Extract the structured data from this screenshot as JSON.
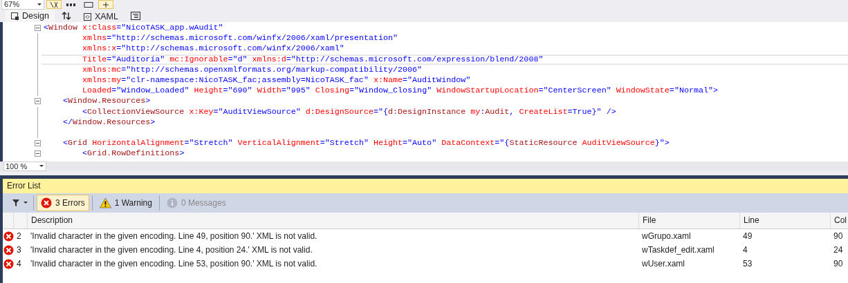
{
  "toolbar": {
    "zoom": "67%",
    "buttons": [
      {
        "kind": "fx",
        "on": true
      },
      {
        "kind": "grid",
        "on": false
      },
      {
        "kind": "snap",
        "on": false
      },
      {
        "kind": "pointer",
        "on": true
      }
    ]
  },
  "view_tabs": [
    {
      "kind": "design-tab",
      "label": "Design",
      "selected": true
    },
    {
      "kind": "swap"
    },
    {
      "kind": "xaml-tab",
      "label": "XAML",
      "selected": false
    },
    {
      "kind": "outline"
    }
  ],
  "editor": {
    "zoom": "100 %",
    "lines": [
      {
        "kind": "element",
        "fold": true,
        "current": false,
        "tokens": [
          {
            "kind": "punct",
            "text": "<"
          },
          {
            "kind": "tag",
            "text": "Window"
          },
          {
            "kind": "attr",
            "text": " x:Class"
          },
          {
            "kind": "punct",
            "text": "="
          },
          {
            "kind": "value",
            "text": "\"NicoTASK_app.wAudit\""
          }
        ],
        "children": [
          {
            "kind": "continuation",
            "fold": false,
            "current": false,
            "tokens": [
              {
                "kind": "attr",
                "text": "xmlns"
              },
              {
                "kind": "punct",
                "text": "="
              },
              {
                "kind": "value",
                "text": "\"http://schemas.microsoft.com/winfx/2006/xaml/presentation\""
              }
            ]
          },
          {
            "kind": "continuation",
            "fold": false,
            "current": false,
            "tokens": [
              {
                "kind": "attr",
                "text": "xmlns:x"
              },
              {
                "kind": "punct",
                "text": "="
              },
              {
                "kind": "value",
                "text": "\"http://schemas.microsoft.com/winfx/2006/xaml\""
              }
            ]
          },
          {
            "kind": "continuation",
            "fold": false,
            "current": true,
            "tokens": [
              {
                "kind": "attr",
                "text": "Title"
              },
              {
                "kind": "punct",
                "text": "="
              },
              {
                "kind": "value",
                "text": "\"Auditoría\""
              },
              {
                "kind": "attr",
                "text": " mc:Ignorable"
              },
              {
                "kind": "punct",
                "text": "="
              },
              {
                "kind": "value",
                "text": "\"d\""
              },
              {
                "kind": "attr",
                "text": " xmlns:d"
              },
              {
                "kind": "punct",
                "text": "="
              },
              {
                "kind": "value",
                "text": "\"http://schemas.microsoft.com/expression/blend/2008\""
              }
            ]
          },
          {
            "kind": "continuation",
            "fold": false,
            "current": false,
            "tokens": [
              {
                "kind": "attr",
                "text": "xmlns:mc"
              },
              {
                "kind": "punct",
                "text": "="
              },
              {
                "kind": "value",
                "text": "\"http://schemas.openxmlformats.org/markup-compatibility/2006\""
              }
            ]
          },
          {
            "kind": "continuation",
            "fold": false,
            "current": false,
            "tokens": [
              {
                "kind": "attr",
                "text": "xmlns:my"
              },
              {
                "kind": "punct",
                "text": "="
              },
              {
                "kind": "value",
                "text": "\"clr-namespace:NicoTASK_fac;assembly=NicoTASK_fac\""
              },
              {
                "kind": "attr",
                "text": " x:Name"
              },
              {
                "kind": "punct",
                "text": "="
              },
              {
                "kind": "value",
                "text": "\"AuditWindow\""
              }
            ]
          },
          {
            "kind": "continuation",
            "fold": false,
            "current": false,
            "tokens": [
              {
                "kind": "attr",
                "text": "Loaded"
              },
              {
                "kind": "punct",
                "text": "="
              },
              {
                "kind": "value",
                "text": "\"Window_Loaded\""
              },
              {
                "kind": "attr",
                "text": " Height"
              },
              {
                "kind": "punct",
                "text": "="
              },
              {
                "kind": "value",
                "text": "\"690\""
              },
              {
                "kind": "attr",
                "text": " Width"
              },
              {
                "kind": "punct",
                "text": "="
              },
              {
                "kind": "value",
                "text": "\"995\""
              },
              {
                "kind": "attr",
                "text": " Closing"
              },
              {
                "kind": "punct",
                "text": "="
              },
              {
                "kind": "value",
                "text": "\"Window_Closing\""
              },
              {
                "kind": "attr",
                "text": " WindowStartupLocation"
              },
              {
                "kind": "punct",
                "text": "="
              },
              {
                "kind": "value",
                "text": "\"CenterScreen\""
              },
              {
                "kind": "attr",
                "text": " WindowState"
              },
              {
                "kind": "punct",
                "text": "="
              },
              {
                "kind": "value",
                "text": "\"Normal\""
              },
              {
                "kind": "punct",
                "text": ">"
              }
            ]
          },
          {
            "kind": "element",
            "fold": true,
            "current": false,
            "tokens": [
              {
                "kind": "punct",
                "text": "<"
              },
              {
                "kind": "tag",
                "text": "Window.Resources"
              },
              {
                "kind": "punct",
                "text": ">"
              }
            ],
            "children": [
              {
                "kind": "element",
                "fold": false,
                "current": false,
                "tokens": [
                  {
                    "kind": "punct",
                    "text": "<"
                  },
                  {
                    "kind": "tag",
                    "text": "CollectionViewSource"
                  },
                  {
                    "kind": "attr",
                    "text": " x:Key"
                  },
                  {
                    "kind": "punct",
                    "text": "="
                  },
                  {
                    "kind": "value",
                    "text": "\"AuditViewSource\""
                  },
                  {
                    "kind": "attr",
                    "text": " d:DesignSource"
                  },
                  {
                    "kind": "punct",
                    "text": "=\"{"
                  },
                  {
                    "kind": "tag",
                    "text": "d:DesignInstance"
                  },
                  {
                    "kind": "attr",
                    "text": " my"
                  },
                  {
                    "kind": "punct",
                    "text": ":"
                  },
                  {
                    "kind": "tag",
                    "text": "Audit"
                  },
                  {
                    "kind": "punct",
                    "text": ","
                  },
                  {
                    "kind": "attr",
                    "text": " CreateList"
                  },
                  {
                    "kind": "punct",
                    "text": "=True}\" />"
                  }
                ]
              }
            ]
          },
          {
            "kind": "element",
            "fold": false,
            "current": false,
            "tokens": [
              {
                "kind": "punct",
                "text": "</"
              },
              {
                "kind": "tag",
                "text": "Window.Resources"
              },
              {
                "kind": "punct",
                "text": ">"
              }
            ]
          },
          {
            "kind": "blank",
            "fold": false
          },
          {
            "kind": "element",
            "fold": true,
            "current": false,
            "tokens": [
              {
                "kind": "punct",
                "text": "<"
              },
              {
                "kind": "tag",
                "text": "Grid"
              },
              {
                "kind": "attr",
                "text": " HorizontalAlignment"
              },
              {
                "kind": "punct",
                "text": "="
              },
              {
                "kind": "value",
                "text": "\"Stretch\""
              },
              {
                "kind": "attr",
                "text": " VerticalAlignment"
              },
              {
                "kind": "punct",
                "text": "="
              },
              {
                "kind": "value",
                "text": "\"Stretch\""
              },
              {
                "kind": "attr",
                "text": " Height"
              },
              {
                "kind": "punct",
                "text": "="
              },
              {
                "kind": "value",
                "text": "\"Auto\""
              },
              {
                "kind": "attr",
                "text": " DataContext"
              },
              {
                "kind": "punct",
                "text": "=\"{"
              },
              {
                "kind": "tag",
                "text": "StaticResource"
              },
              {
                "kind": "attr",
                "text": " AuditViewSource"
              },
              {
                "kind": "punct",
                "text": "}\">"
              }
            ],
            "children": [
              {
                "kind": "element",
                "fold": true,
                "current": false,
                "tokens": [
                  {
                    "kind": "punct",
                    "text": "<"
                  },
                  {
                    "kind": "tag",
                    "text": "Grid.RowDefinitions"
                  },
                  {
                    "kind": "punct",
                    "text": ">"
                  }
                ]
              }
            ]
          }
        ]
      }
    ]
  },
  "error_list": {
    "title": "Error List",
    "filters": [
      {
        "kind": "error",
        "label": "3 Errors",
        "selected": true,
        "disabled": false
      },
      {
        "kind": "warning",
        "label": "1 Warning",
        "selected": false,
        "disabled": false
      },
      {
        "kind": "info",
        "label": "0 Messages",
        "selected": false,
        "disabled": true
      }
    ],
    "columns": [
      "Description",
      "File",
      "Line",
      "Col"
    ],
    "rows": [
      {
        "kind": "error",
        "number": "2",
        "description": "'Invalid character in the given encoding. Line 49, position 90.' XML is not valid.",
        "file": "wGrupo.xaml",
        "line": "49",
        "column": "90"
      },
      {
        "kind": "error",
        "number": "3",
        "description": "'Invalid character in the given encoding. Line 4, position 24.' XML is not valid.",
        "file": "wTaskdef_edit.xaml",
        "line": "4",
        "column": "24"
      },
      {
        "kind": "error",
        "number": "4",
        "description": "'Invalid character in the given encoding. Line 53, position 90.' XML is not valid.",
        "file": "wUser.xaml",
        "line": "53",
        "column": "90"
      }
    ]
  }
}
